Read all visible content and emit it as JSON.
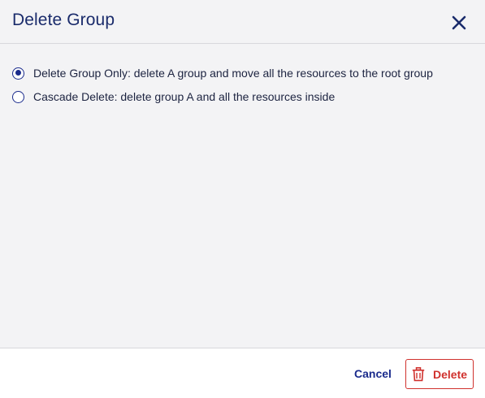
{
  "dialog": {
    "title": "Delete Group",
    "close_icon": "close-icon"
  },
  "options": [
    {
      "label": "Delete Group Only: delete A group and move all the resources to the root group",
      "selected": true
    },
    {
      "label": "Cascade Delete: delete group A and all the resources inside",
      "selected": false
    }
  ],
  "footer": {
    "cancel_label": "Cancel",
    "delete_label": "Delete",
    "delete_icon": "trash-icon"
  },
  "colors": {
    "primary": "#1a2b8c",
    "danger": "#d0312d",
    "background": "#f3f3f5"
  }
}
